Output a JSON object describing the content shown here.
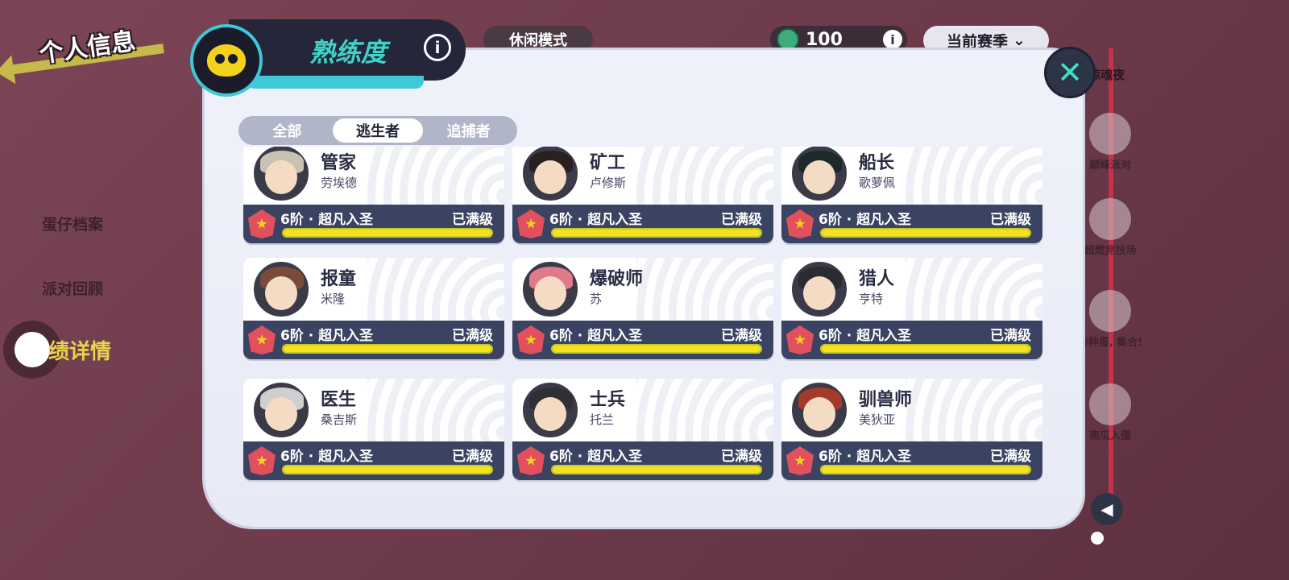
{
  "header": {
    "back_title": "个人信息"
  },
  "left_menu": [
    {
      "label": "蛋仔档案"
    },
    {
      "label": "派对回顾"
    },
    {
      "label": "绩详情",
      "active": true
    }
  ],
  "topbar": {
    "mode": "休闲模式",
    "currency_value": "100",
    "season": "当前赛季",
    "season_event": "出惊魂夜"
  },
  "panel": {
    "title": "熟练度",
    "tabs": [
      {
        "label": "全部"
      },
      {
        "label": "逃生者",
        "active": true
      },
      {
        "label": "追捕者"
      }
    ],
    "cards": [
      {
        "name": "管家",
        "sub": "劳埃德",
        "rank": "6阶 · 超凡入圣",
        "status": "已满级",
        "progress": 1.0,
        "hair": "#c9c2b2"
      },
      {
        "name": "矿工",
        "sub": "卢修斯",
        "rank": "6阶 · 超凡入圣",
        "status": "已满级",
        "progress": 1.0,
        "hair": "#2a2020"
      },
      {
        "name": "船长",
        "sub": "歌萝佩",
        "rank": "6阶 · 超凡入圣",
        "status": "已满级",
        "progress": 1.0,
        "hair": "#1d2a2a"
      },
      {
        "name": "报童",
        "sub": "米隆",
        "rank": "6阶 · 超凡入圣",
        "status": "已满级",
        "progress": 1.0,
        "hair": "#7a4a3a"
      },
      {
        "name": "爆破师",
        "sub": "苏",
        "rank": "6阶 · 超凡入圣",
        "status": "已满级",
        "progress": 1.0,
        "hair": "#e07a8a"
      },
      {
        "name": "猎人",
        "sub": "亨特",
        "rank": "6阶 · 超凡入圣",
        "status": "已满级",
        "progress": 1.0,
        "hair": "#2b2b32"
      },
      {
        "name": "医生",
        "sub": "桑吉斯",
        "rank": "6阶 · 超凡入圣",
        "status": "已满级",
        "progress": 1.0,
        "hair": "#cfcfcf"
      },
      {
        "name": "士兵",
        "sub": "托兰",
        "rank": "6阶 · 超凡入圣",
        "status": "已满级",
        "progress": 1.0,
        "hair": "#2f2f35"
      },
      {
        "name": "驯兽师",
        "sub": "美狄亚",
        "rank": "6阶 · 超凡入圣",
        "status": "已满级",
        "progress": 1.0,
        "hair": "#a33a2a"
      }
    ]
  },
  "right_rail": [
    {
      "label": "巅峰派对"
    },
    {
      "label": "超燃竞技场"
    },
    {
      "label": "特种蛋, 集合!"
    },
    {
      "label": "南瓜入侵"
    }
  ],
  "colors": {
    "accent": "#40d2c7",
    "bar": "#3a4462",
    "progress": "#f3e21d",
    "rank_badge": "#e2505d"
  },
  "icons": {
    "back": "arrow-left-icon",
    "close": "close-icon",
    "info": "info-icon",
    "collapse": "chevron-left-icon",
    "emblem": "proficiency-emblem-icon"
  }
}
